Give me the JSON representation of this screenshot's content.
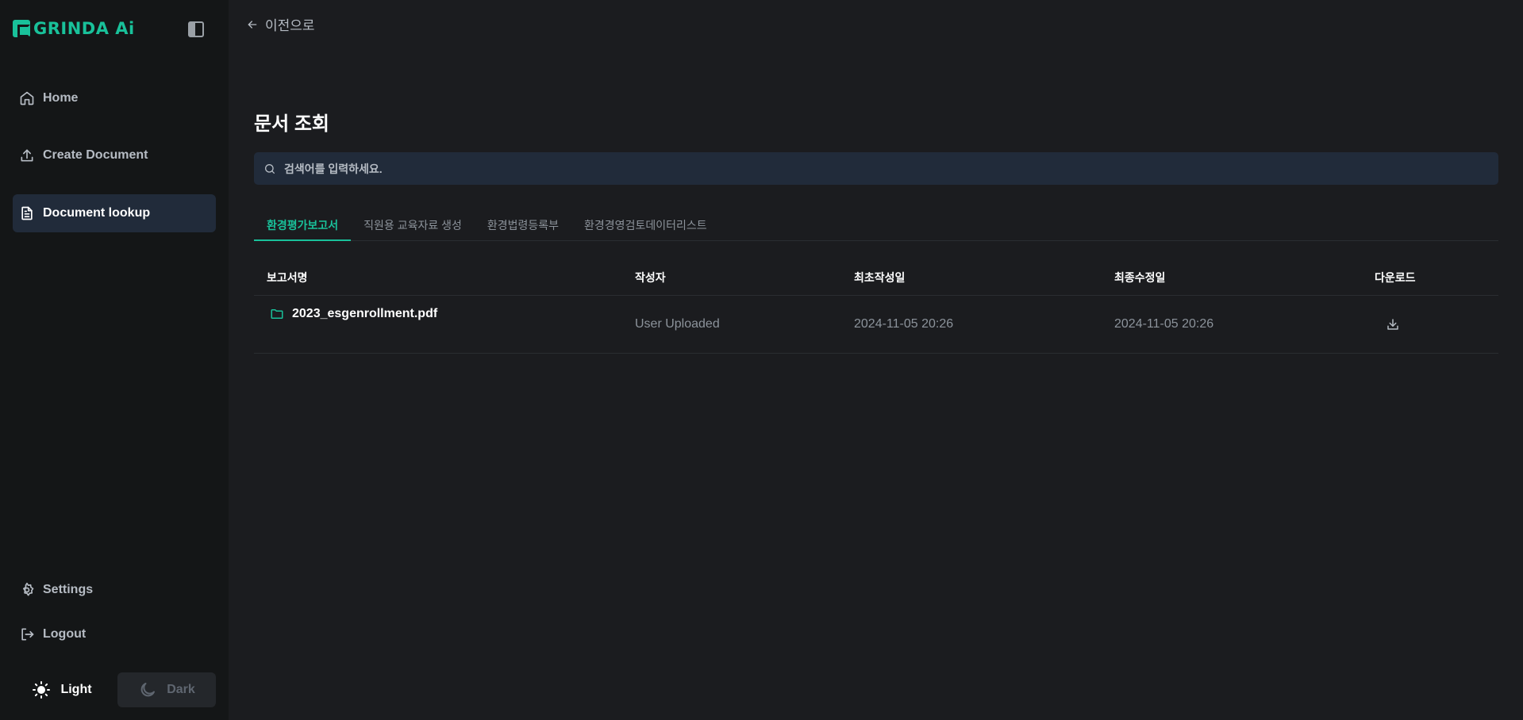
{
  "brand": {
    "name": "GRINDA Ai",
    "accent": "#19c19a"
  },
  "sidebar": {
    "items": [
      {
        "label": "Home",
        "icon": "home-icon"
      },
      {
        "label": "Create Document",
        "icon": "upload-icon"
      },
      {
        "label": "Document lookup",
        "icon": "document-icon",
        "active": true
      }
    ],
    "bottom": [
      {
        "label": "Settings",
        "icon": "gear-icon"
      },
      {
        "label": "Logout",
        "icon": "logout-icon"
      }
    ],
    "theme": {
      "light_label": "Light",
      "dark_label": "Dark",
      "selected": "Light"
    }
  },
  "header": {
    "back_label": "이전으로"
  },
  "main": {
    "title": "문서 조회",
    "search": {
      "placeholder": "검색어를 입력하세요.",
      "value": ""
    },
    "tabs": [
      {
        "label": "환경평가보고서",
        "active": true
      },
      {
        "label": "직원용 교육자료 생성"
      },
      {
        "label": "환경법령등록부"
      },
      {
        "label": "환경경영검토데이터리스트"
      }
    ],
    "table": {
      "columns": [
        "보고서명",
        "작성자",
        "최초작성일",
        "최종수정일",
        "다운로드"
      ],
      "rows": [
        {
          "name": "2023_esgenrollment.pdf",
          "author": "User Uploaded",
          "created": "2024-11-05 20:26",
          "modified": "2024-11-05 20:26",
          "icon": "folder-icon",
          "download_icon": "download-icon"
        }
      ]
    }
  }
}
